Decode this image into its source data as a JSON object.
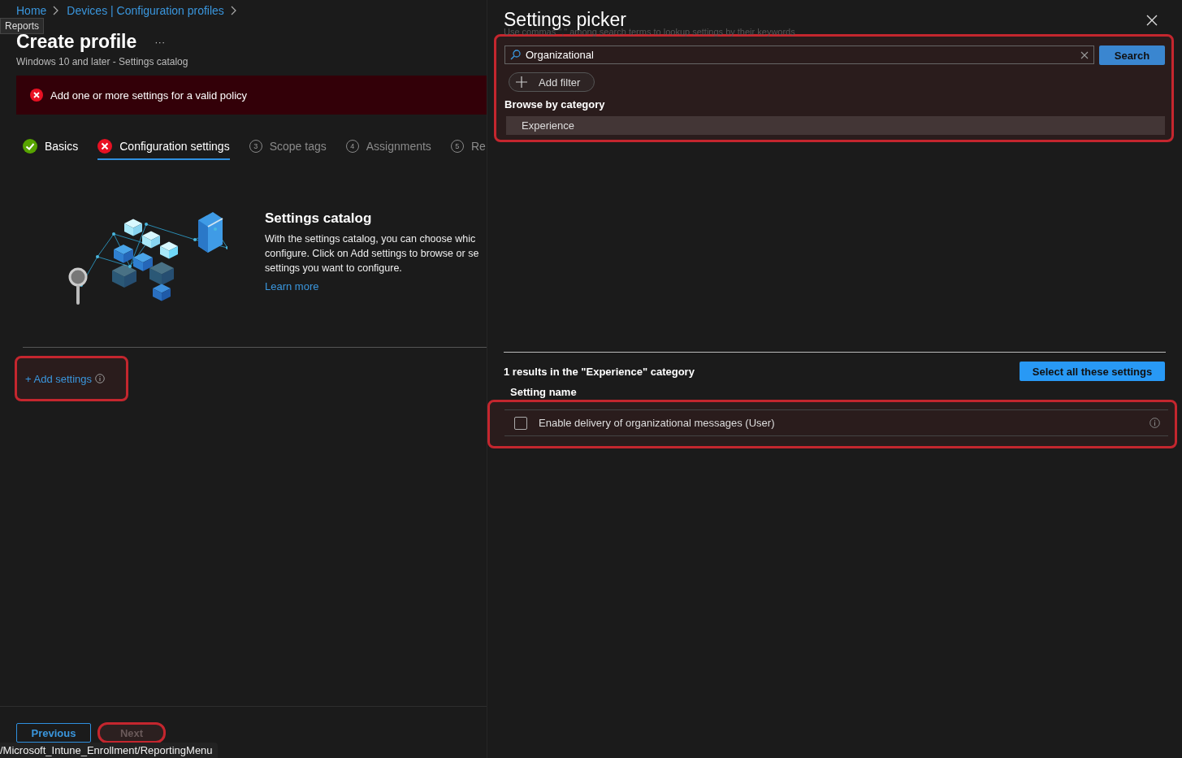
{
  "tooltip": "Reports",
  "breadcrumb": [
    {
      "label": "Home"
    },
    {
      "label": "Devices | Configuration profiles"
    }
  ],
  "page": {
    "title": "Create profile",
    "more": "···",
    "subtitle": "Windows 10 and later - Settings catalog"
  },
  "error_banner": "Add one or more settings for a valid policy",
  "steps": [
    {
      "kind": "done",
      "label": "Basics",
      "selected": false
    },
    {
      "kind": "error",
      "label": "Configuration settings",
      "selected": true
    },
    {
      "kind": "number",
      "number": "3",
      "label": "Scope tags",
      "selected": false
    },
    {
      "kind": "number",
      "number": "4",
      "label": "Assignments",
      "selected": false
    },
    {
      "kind": "number",
      "number": "5",
      "label": "Re",
      "selected": false
    }
  ],
  "catalog": {
    "title": "Settings catalog",
    "description": [
      "With the settings catalog, you can choose whic",
      "configure. Click on Add settings to browse or se",
      "settings you want to configure."
    ],
    "link": "Learn more"
  },
  "add_settings": {
    "label": "+ Add settings",
    "highlighted": true
  },
  "footer": {
    "buttons": [
      {
        "label": "Previous",
        "kind": "secondary",
        "disabled": false,
        "highlighted": false
      },
      {
        "label": "Next",
        "kind": "primary",
        "disabled": true,
        "highlighted": true
      }
    ]
  },
  "status_url": "/Microsoft_Intune_Enrollment/ReportingMenu",
  "picker": {
    "title": "Settings picker",
    "hint": "Use commas \",\" among search terms to lookup settings by their keywords",
    "highlighted": true,
    "search": {
      "value": "Organizational",
      "button": "Search"
    },
    "add_filter": "Add filter",
    "browse_heading": "Browse by category",
    "categories": [
      {
        "label": "Experience",
        "selected": true
      }
    ],
    "results_text": "1 results in the \"Experience\" category",
    "select_all": "Select all these settings",
    "column": "Setting name",
    "settings": [
      {
        "name": "Enable delivery of organizational messages (User)",
        "checked": false,
        "highlighted": true
      }
    ]
  }
}
